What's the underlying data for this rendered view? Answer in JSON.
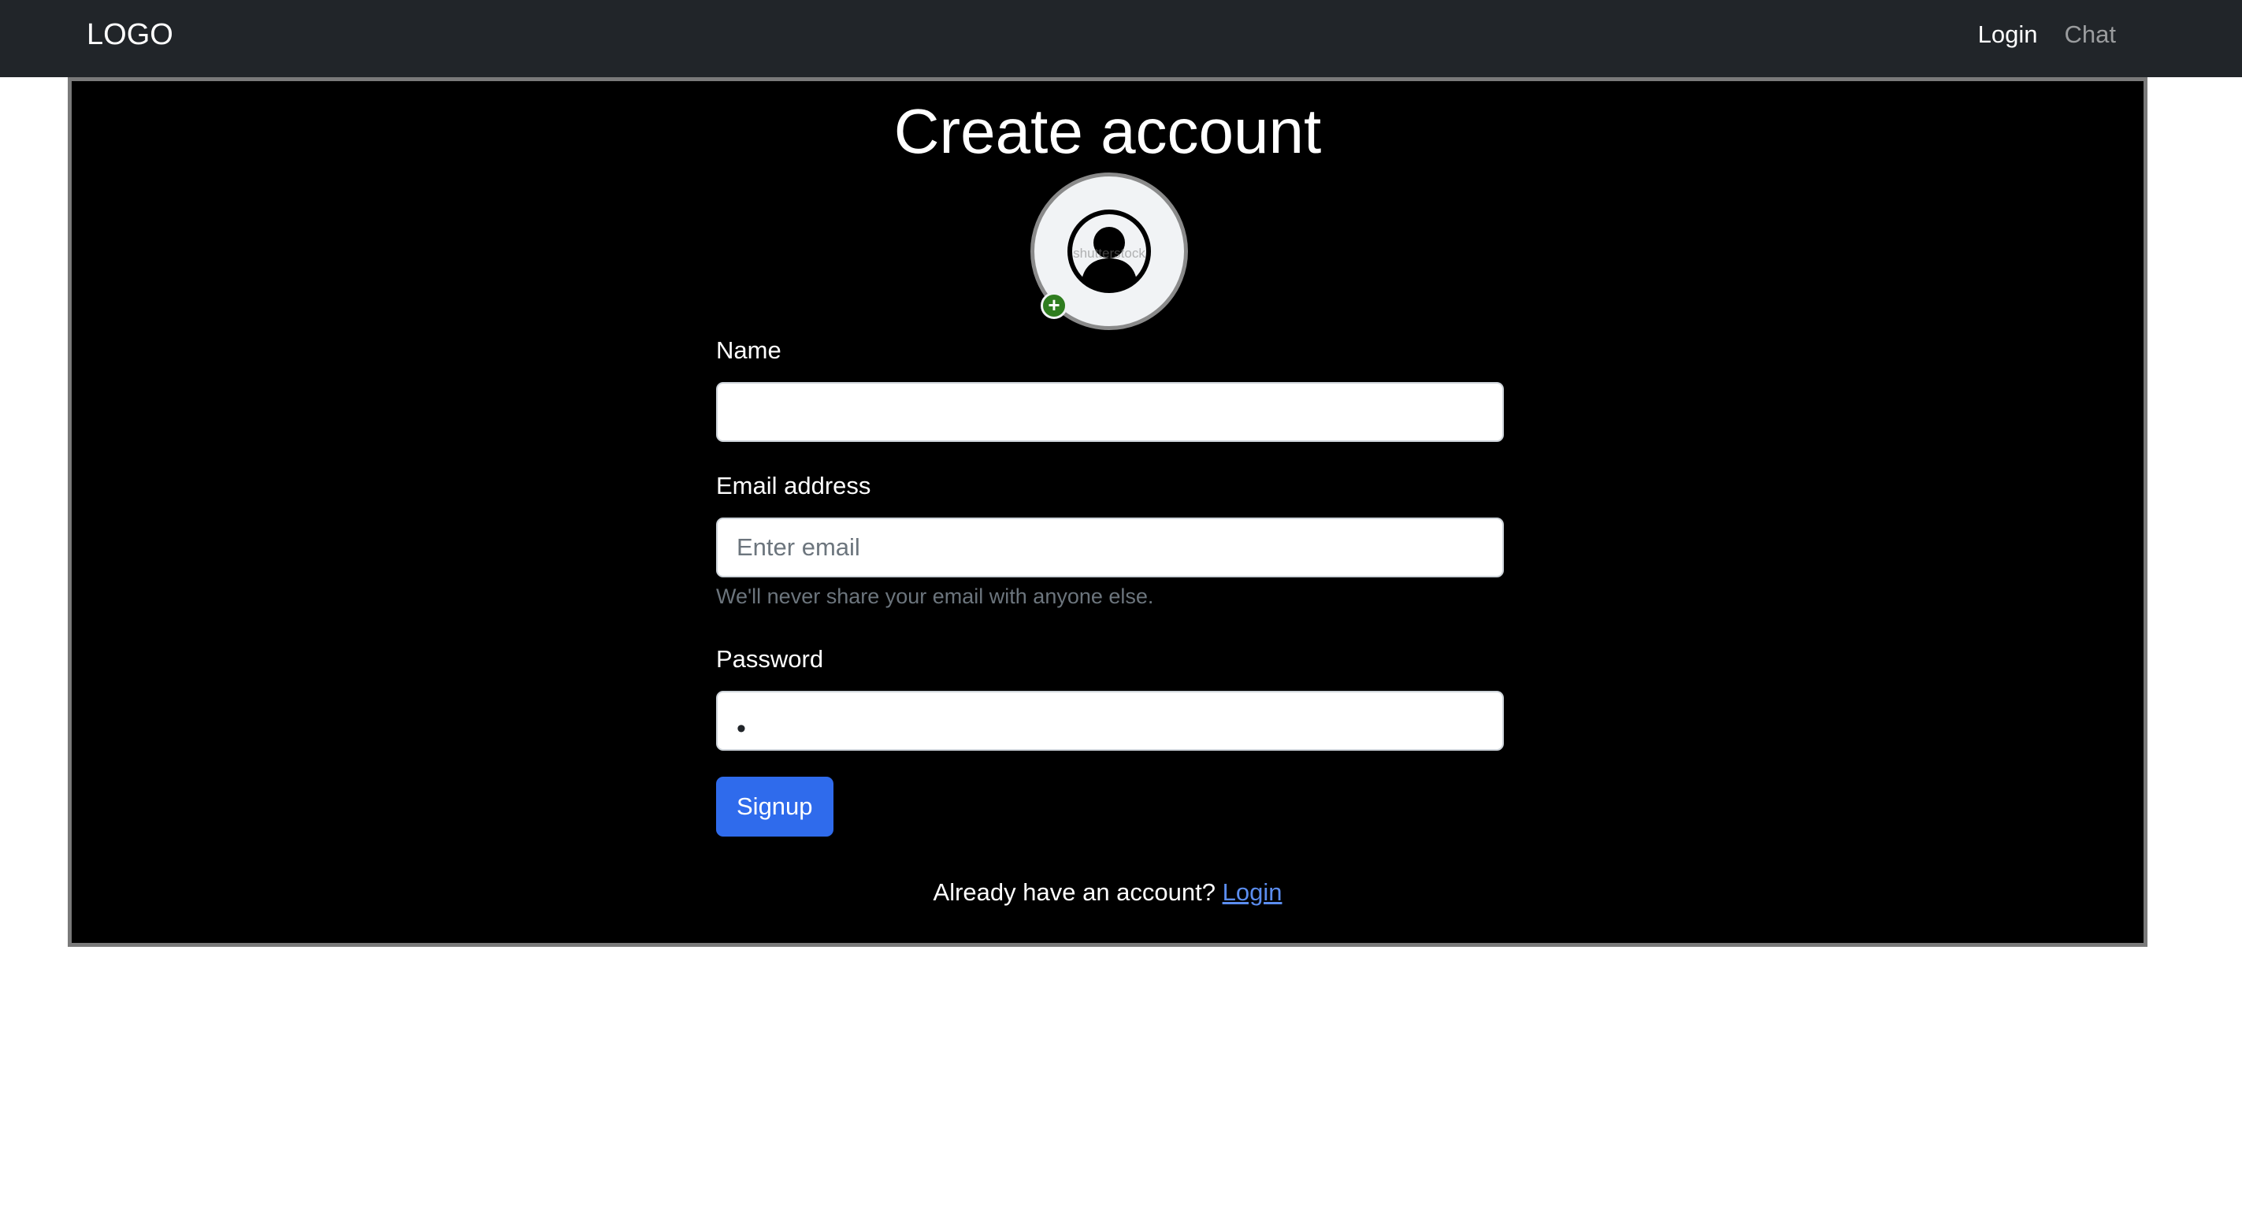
{
  "navbar": {
    "logo": "LOGO",
    "links": [
      {
        "label": "Login",
        "active": true
      },
      {
        "label": "Chat",
        "active": false
      }
    ]
  },
  "page": {
    "title": "Create account"
  },
  "avatar": {
    "icon": "user-circle-icon",
    "add_icon": "plus-icon",
    "add_badge_color": "#2f7d1f",
    "watermark": "shutterstock"
  },
  "form": {
    "name_label": "Name",
    "name_value": "",
    "email_label": "Email address",
    "email_placeholder": "Enter email",
    "email_value": "",
    "email_help": "We'll never share your email with anyone else.",
    "password_label": "Password",
    "password_mask": "•",
    "submit_label": "Signup"
  },
  "footer": {
    "prompt": "Already have an account?",
    "link_label": "Login"
  },
  "colors": {
    "navbar_bg": "#212529",
    "panel_bg": "#000000",
    "primary": "#2f6bec",
    "link": "#5b8def"
  }
}
